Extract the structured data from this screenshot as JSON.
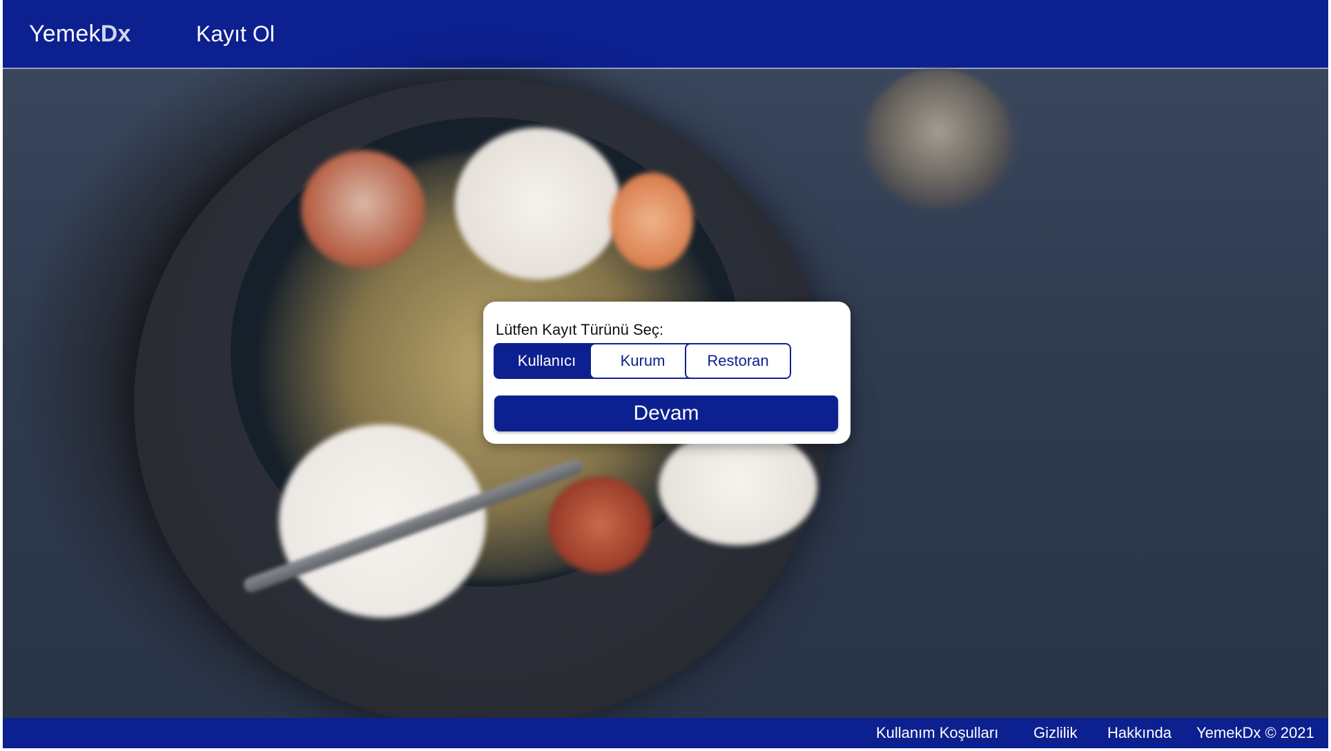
{
  "header": {
    "brand_light": "Yemek",
    "brand_bold": "Dx",
    "nav_register": "Kayıt Ol"
  },
  "dialog": {
    "title": "Lütfen Kayıt Türünü Seç:",
    "options": [
      {
        "label": "Kullanıcı",
        "selected": true
      },
      {
        "label": "Kurum",
        "selected": false
      },
      {
        "label": "Restoran",
        "selected": false
      }
    ],
    "continue_label": "Devam"
  },
  "footer": {
    "terms": "Kullanım Koşulları",
    "privacy": "Gizlilik",
    "about": "Hakkında",
    "copyright": "YemekDx © 2021"
  },
  "colors": {
    "primary": "#0d2090",
    "background_dark": "#2f3a4f",
    "white": "#ffffff"
  }
}
